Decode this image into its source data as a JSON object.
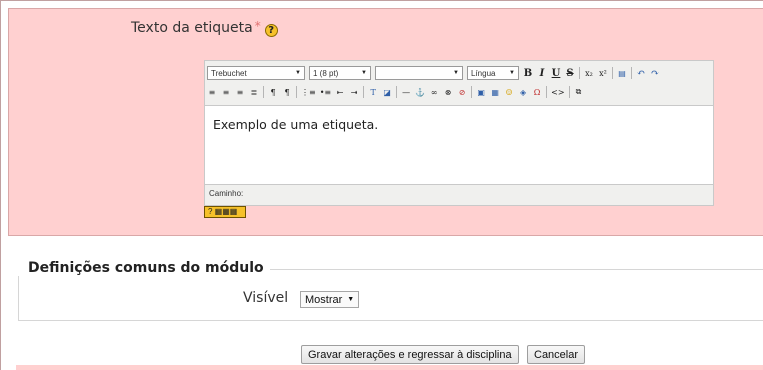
{
  "form": {
    "label_text": "Texto da etiqueta",
    "required_mark": "*",
    "help_glyph": "?"
  },
  "editor": {
    "font_family": "Trebuchet",
    "font_size": "1 (8 pt)",
    "style_value": "",
    "language": "Língua",
    "content": "Exemplo de uma etiqueta.",
    "path_label": "Caminho:",
    "keyboard_help_label": "?"
  },
  "section": {
    "legend": "Definições comuns do módulo",
    "visible_label": "Visível",
    "visible_value": "Mostrar"
  },
  "buttons": {
    "save": "Gravar alterações e regressar à disciplina",
    "cancel": "Cancelar"
  },
  "colors": {
    "required_bg": "#ffd0d0",
    "help_icon": "#f6c12a"
  }
}
